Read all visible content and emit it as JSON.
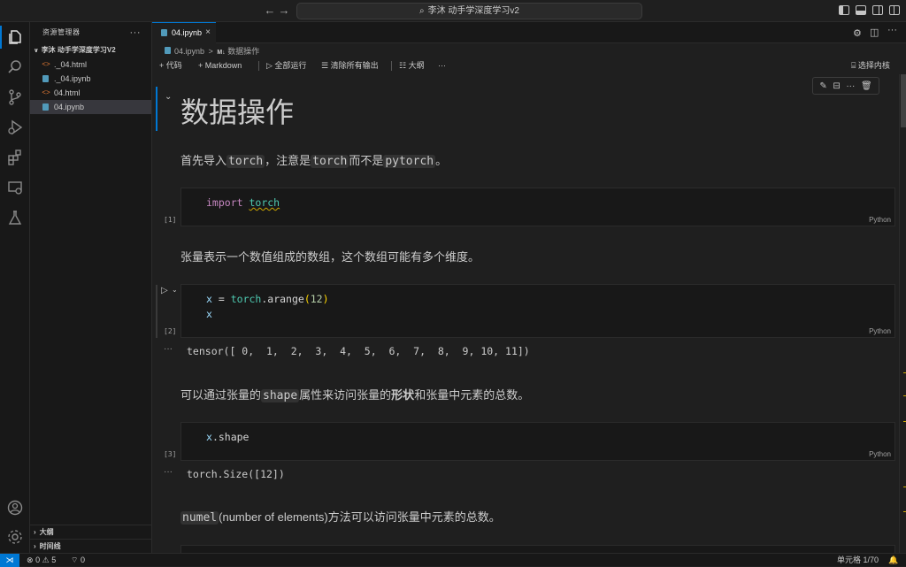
{
  "titlebar": {
    "back": "←",
    "forward": "→",
    "search_text": "李沐 动手学深度学习v2"
  },
  "sidebar": {
    "title": "资源管理器",
    "folder": "李沐 动手学深度学习V2",
    "files": [
      {
        "name": "._04.html",
        "type": "html"
      },
      {
        "name": "._04.ipynb",
        "type": "notebook"
      },
      {
        "name": "04.html",
        "type": "html"
      },
      {
        "name": "04.ipynb",
        "type": "notebook",
        "selected": true
      }
    ],
    "outline": "大纲",
    "timeline": "时间线"
  },
  "tabs": [
    {
      "label": "04.ipynb",
      "close": "×"
    }
  ],
  "breadcrumb": {
    "file": "04.ipynb",
    "sep": ">",
    "md_badge": "M↓",
    "section": "数据操作"
  },
  "toolbar": {
    "add_code": "代码",
    "add_markdown": "Markdown",
    "run_all": "全部运行",
    "clear_outputs": "清除所有输出",
    "outline": "大纲",
    "more": "···",
    "select_kernel": "选择内核"
  },
  "notebook": {
    "heading": "数据操作",
    "p1": {
      "a": "首先导入",
      "b": "torch",
      "c": "，注意是",
      "d": "torch",
      "e": "而不是",
      "f": "pytorch",
      "g": "。"
    },
    "cell1": {
      "count": "[1]",
      "kw": "import",
      "mod": "torch",
      "lang": "Python"
    },
    "p2": "张量表示一个数值组成的数组，这个数组可能有多个维度。",
    "cell2": {
      "count": "[2]",
      "line1_var": "x",
      "line1_eq": " = ",
      "line1_mod": "torch",
      "line1_fn": ".arange",
      "line1_open": "(",
      "line1_num": "12",
      "line1_close": ")",
      "line2": "x",
      "lang": "Python"
    },
    "out2": "tensor([ 0,  1,  2,  3,  4,  5,  6,  7,  8,  9, 10, 11])",
    "p3": {
      "a": "可以通过张量的",
      "b": "shape",
      "c": "属性来访问张量的",
      "d": "形状",
      "e": "和张量中元素的总数。"
    },
    "cell3": {
      "count": "[3]",
      "var": "x",
      "attr": ".shape",
      "lang": "Python"
    },
    "out3": "torch.Size([12])",
    "p4": {
      "a": "numel",
      "b": "(number of elements)方法可以访问张量中元素的总数。"
    },
    "out_dots": "···"
  },
  "statusbar": {
    "errors": "0",
    "warnings": "5",
    "ports": "0",
    "cell_position": "单元格 1/70"
  },
  "colors": {
    "accent": "#0078d4",
    "bg": "#1f1f1f"
  }
}
